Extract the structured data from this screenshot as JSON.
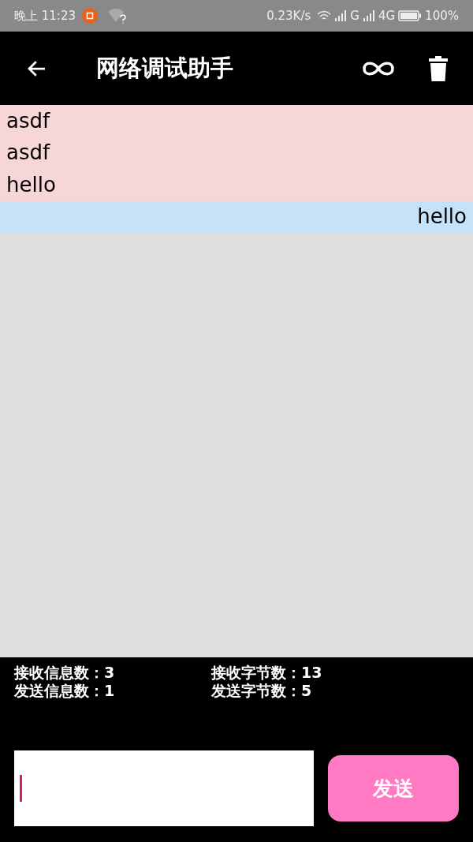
{
  "status_bar": {
    "time": "晚上 11:23",
    "speed": "0.23K/s",
    "network_1": "G",
    "network_2": "4G",
    "battery": "100%"
  },
  "toolbar": {
    "title": "网络调试助手"
  },
  "messages": [
    {
      "kind": "received",
      "text": "asdf"
    },
    {
      "kind": "received",
      "text": "asdf"
    },
    {
      "kind": "received",
      "text": "hello"
    },
    {
      "kind": "sent",
      "text": "hello"
    }
  ],
  "stats": [
    {
      "label": "接收信息数：3"
    },
    {
      "label": "接收字节数：13"
    },
    {
      "label": "发送信息数：1"
    },
    {
      "label": "发送字节数：5"
    }
  ],
  "input": {
    "focused": true
  },
  "send_button": {
    "label": "发送"
  }
}
